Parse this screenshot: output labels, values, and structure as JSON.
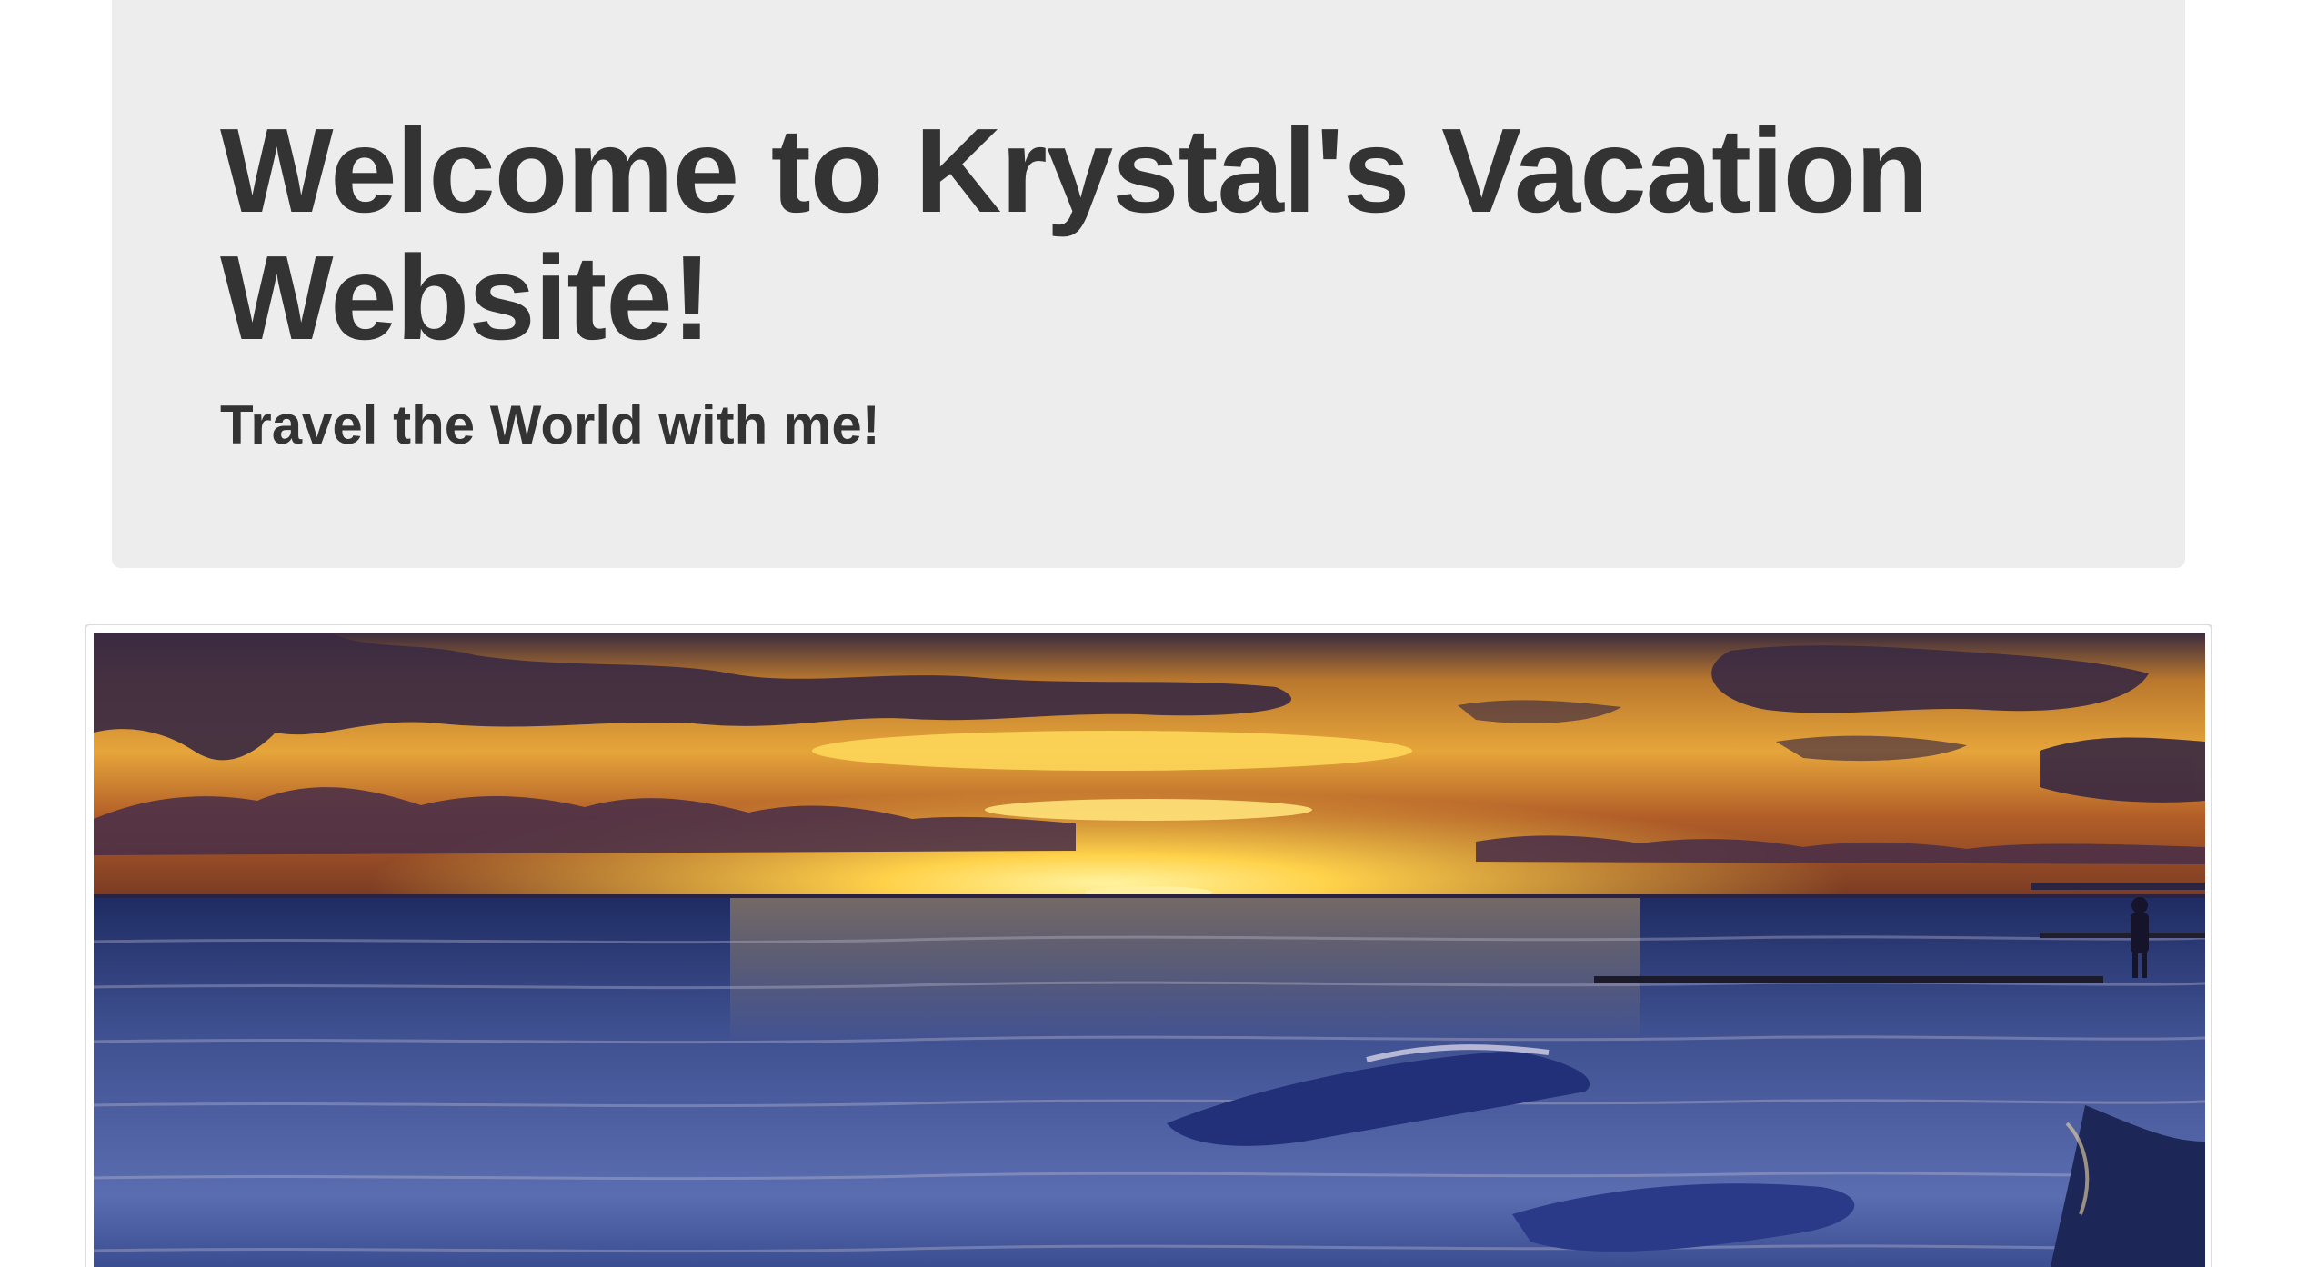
{
  "jumbotron": {
    "title": "Welcome to Krystal's Vacation Website!",
    "subtitle": "Travel the World with me!"
  },
  "gallery": {
    "image_description_icon": "beach-sunset-photo"
  },
  "colors": {
    "jumbotron_background": "#ededed",
    "text": "#333333",
    "thumbnail_border": "#dddddd"
  }
}
